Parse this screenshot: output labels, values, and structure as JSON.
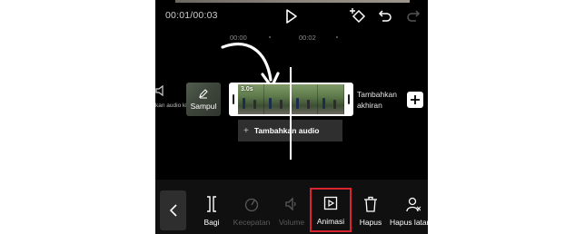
{
  "player": {
    "time": "00:01/00:03"
  },
  "ruler": {
    "mark1": "00:00",
    "mark2": "00:02"
  },
  "timeline": {
    "audio_left_label": "kan audio klip",
    "cover_label": "Sampul",
    "clip_duration": "3.0s",
    "add_end_label": "Tambahkan akhiran",
    "add_audio_label": "Tambahkan audio"
  },
  "toolbar": {
    "items": [
      {
        "label": "Bagi",
        "icon": "split-icon",
        "enabled": true
      },
      {
        "label": "Kecepatan",
        "icon": "speed-icon",
        "enabled": false
      },
      {
        "label": "Volume",
        "icon": "volume-icon",
        "enabled": false
      },
      {
        "label": "Animasi",
        "icon": "animation-icon",
        "enabled": true,
        "highlighted": true
      },
      {
        "label": "Hapus",
        "icon": "trash-icon",
        "enabled": true
      },
      {
        "label": "Hapus latar belakang",
        "icon": "remove-background-icon",
        "enabled": true
      }
    ]
  },
  "colors": {
    "background": "#000000",
    "toolbar": "#101010",
    "highlight": "#d9232f",
    "disabled_text": "#5a5a5a"
  }
}
